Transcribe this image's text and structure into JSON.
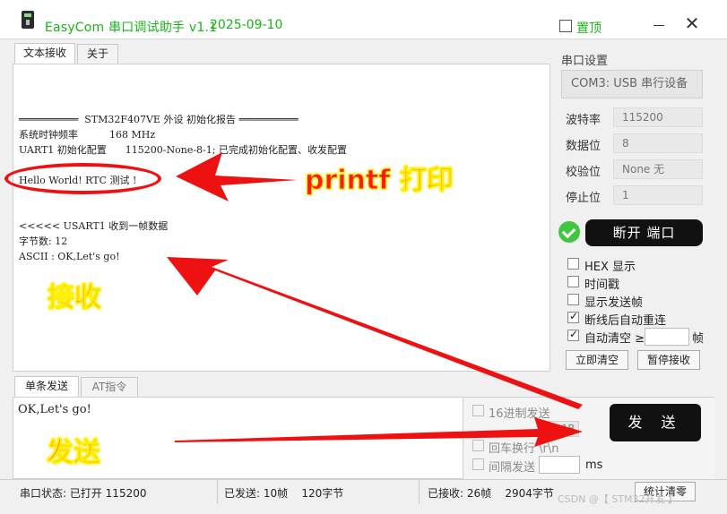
{
  "window": {
    "title": "EasyCom 串口调试助手 v1.1",
    "date": "2025-09-10",
    "pin_label": "置顶",
    "close_glyph": "✕"
  },
  "recv_tabs": [
    {
      "label": "文本接收",
      "active": true
    },
    {
      "label": "关于",
      "active": false
    }
  ],
  "recv_lines": [
    "══════════  STM32F407VE 外设 初始化报告 ══════════",
    "系统时钟频率          168 MHz",
    "UART1 初始化配置      115200-None-8-1; 已完成初始化配置、收发配置",
    "Hello World! RTC 测试 !",
    "<<<<< USART1 收到一帧数据",
    "字节数: 12",
    "ASCII : OK,Let's go!"
  ],
  "serial_settings": {
    "title": "串口设置",
    "port": "COM3: USB 串行设备",
    "params": [
      {
        "label": "波特率",
        "value": "115200"
      },
      {
        "label": "数据位",
        "value": "8"
      },
      {
        "label": "校验位",
        "value": "None   无"
      },
      {
        "label": "停止位",
        "value": "1"
      }
    ],
    "disconnect_label": "断开 端口",
    "options": [
      {
        "label": "HEX 显示",
        "checked": false,
        "enabled": true
      },
      {
        "label": "时间戳",
        "checked": false,
        "enabled": true
      },
      {
        "label": "显示发送帧",
        "checked": false,
        "enabled": true
      },
      {
        "label": "断线后自动重连",
        "checked": true,
        "enabled": true
      },
      {
        "label": "自动清空 ≥",
        "checked": true,
        "enabled": true
      }
    ],
    "clear_unit": "帧",
    "clear_now_label": "立即清空",
    "pause_recv_label": "暂停接收"
  },
  "send_tabs": [
    {
      "label": "单条发送",
      "active": true
    },
    {
      "label": "AT指令",
      "active": false
    }
  ],
  "send": {
    "text": "OK,Let's go!",
    "hex_send_label": "16进制发送",
    "hex_value": "0 1B",
    "crlf_label": "回车换行 \\r\\n",
    "interval_label": "间隔发送",
    "interval_unit": "ms",
    "send_label": "发 送"
  },
  "status": {
    "port_state": "串口状态: 已打开 115200",
    "sent": "已发送: 10帧    120字节",
    "received": "已接收: 26帧    2904字节",
    "stats_clear_label": "统计清零",
    "watermark": "CSDN @【 STM32开发 】"
  },
  "annotations": {
    "printf": "printf 打印",
    "receive": "接收",
    "send": "发送"
  },
  "colors": {
    "title_green": "#19b319",
    "annotation_red": "#ff1a1a",
    "annotation_outline": "#ffef00",
    "connected_green": "#40c640"
  }
}
